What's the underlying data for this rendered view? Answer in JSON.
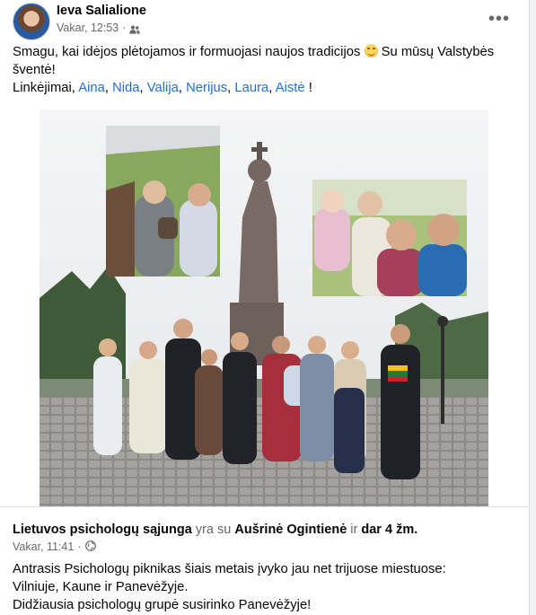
{
  "post": {
    "author": "Ieva Salialione",
    "time": "Vakar, 12:53",
    "separator": "·",
    "audience_icon": "friends-icon",
    "more_label": "•••",
    "caption_line1": "Smagu, kai idėjos plėtojamos ir formuojasi naujos tradicijos",
    "caption_line1_end": "Su mūsų Valstybės",
    "caption_line2": "šventė!",
    "greeting": "Linkėjimai,",
    "mentions": [
      "Aina",
      "Nida",
      "Valija",
      "Nerijus",
      "Laura",
      "Aistė"
    ],
    "mention_sep": ",",
    "greeting_end": "!"
  },
  "shared": {
    "page": "Lietuvos psichologų sąjunga",
    "with_text": "yra su",
    "tagged": "Aušrinė Ogintienė",
    "and_text": "ir",
    "others": "dar 4 žm.",
    "time": "Vakar, 11:41",
    "separator": "·",
    "audience_icon": "globe-icon",
    "lines": [
      "Antrasis Psichologų piknikas šiais metais įvyko jau net trijuose miestuose:",
      "Vilniuje, Kaune ir Panevėžyje.",
      "Didžiausia psichologų grupė susirinko Panevėžyje!"
    ]
  },
  "colors": {
    "link": "#216fdb",
    "secondary_text": "#65676b",
    "primary_text": "#050505"
  }
}
